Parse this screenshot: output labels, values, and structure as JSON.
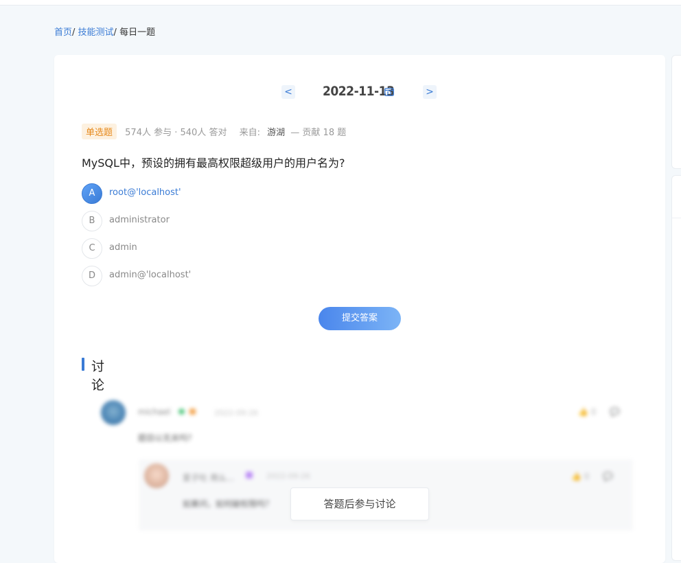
{
  "breadcrumb": {
    "home": "首页",
    "sep1": "/ ",
    "category": "技能测试",
    "sep2": "/ ",
    "current": "每日一题"
  },
  "date_nav": {
    "prev": "<",
    "date": "2022-11-13",
    "next": ">"
  },
  "meta": {
    "tag": "单选题",
    "stats": "574人 参与 · 540人 答对",
    "from_label": "来自:",
    "author": "游湖",
    "contribution": "— 贡献 18 题"
  },
  "question": "MySQL中，预设的拥有最高权限超级用户的用户名为?",
  "options": [
    {
      "letter": "A",
      "text": "root@'localhost'",
      "selected": true
    },
    {
      "letter": "B",
      "text": "administrator",
      "selected": false
    },
    {
      "letter": "C",
      "text": "admin",
      "selected": false
    },
    {
      "letter": "D",
      "text": "admin@'localhost'",
      "selected": false
    }
  ],
  "submit_label": "提交答案",
  "discussion": {
    "title": "讨论",
    "comment": {
      "user": "michael",
      "time": "2022-09-26",
      "likes": "0",
      "text": "题目以无关吗?"
    },
    "reply": {
      "user": "爱子吐 用么...",
      "time": "2022-09-26",
      "likes": "0",
      "text": "如果问，如何破权限吗？"
    },
    "join_label": "答题后参与讨论"
  },
  "colors": {
    "accent": "#3a7bd5",
    "tag_bg": "#fdf1e0",
    "tag_text": "#e6891c"
  }
}
